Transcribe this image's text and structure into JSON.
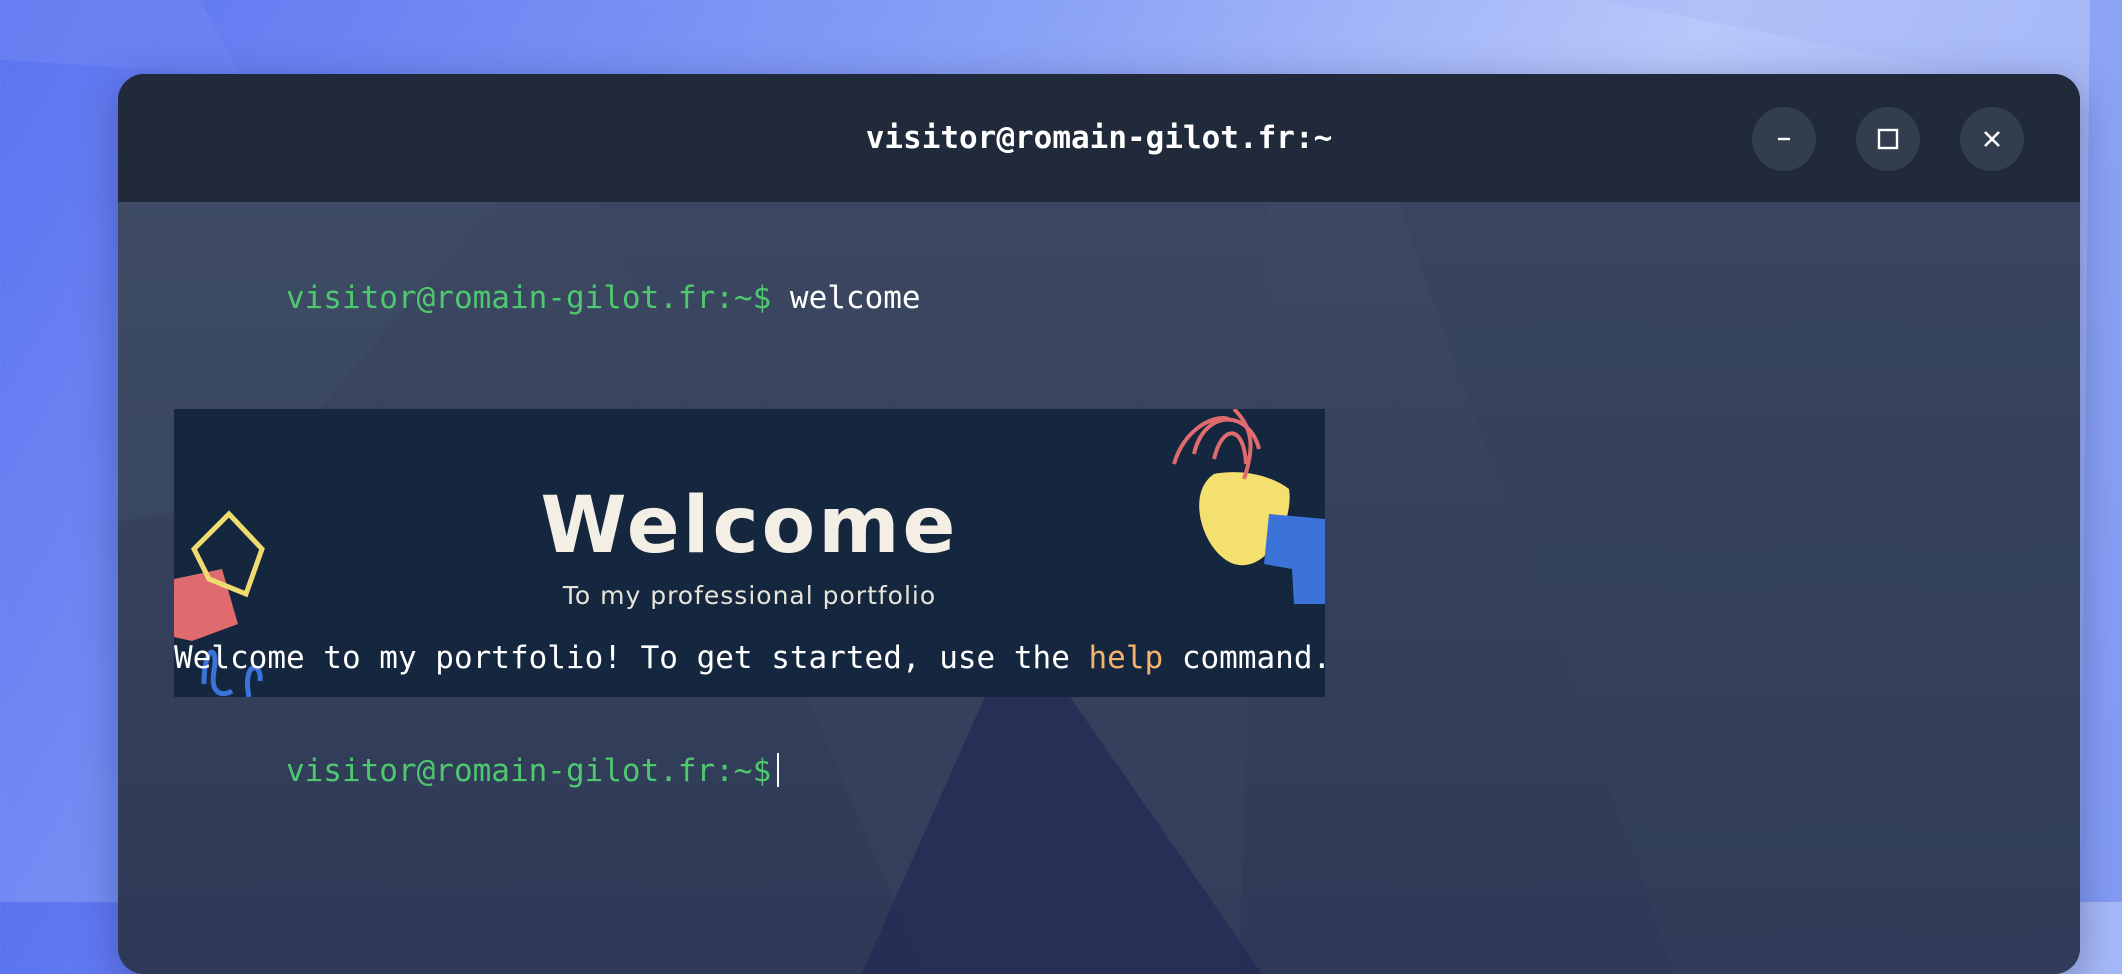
{
  "window": {
    "title": "visitor@romain-gilot.fr:~"
  },
  "controls": {
    "minimize": "−",
    "maximize": "□",
    "close": "✕",
    "minimize_icon": "minimize-icon",
    "maximize_icon": "maximize-icon",
    "close_icon": "close-icon"
  },
  "terminal": {
    "prompt": "visitor@romain-gilot.fr:~$",
    "command": "welcome",
    "banner": {
      "title": "Welcome",
      "subtitle": "To my professional portfolio"
    },
    "message": {
      "before": "Welcome to my portfolio! To get started, use the ",
      "highlight": "help",
      "after": " command."
    },
    "prompt2": "visitor@romain-gilot.fr:~$"
  },
  "colors": {
    "prompt": "#4ec86f",
    "highlight": "#f6b36a",
    "titlebar": "#212a3b",
    "banner_bg": "#14273f"
  }
}
